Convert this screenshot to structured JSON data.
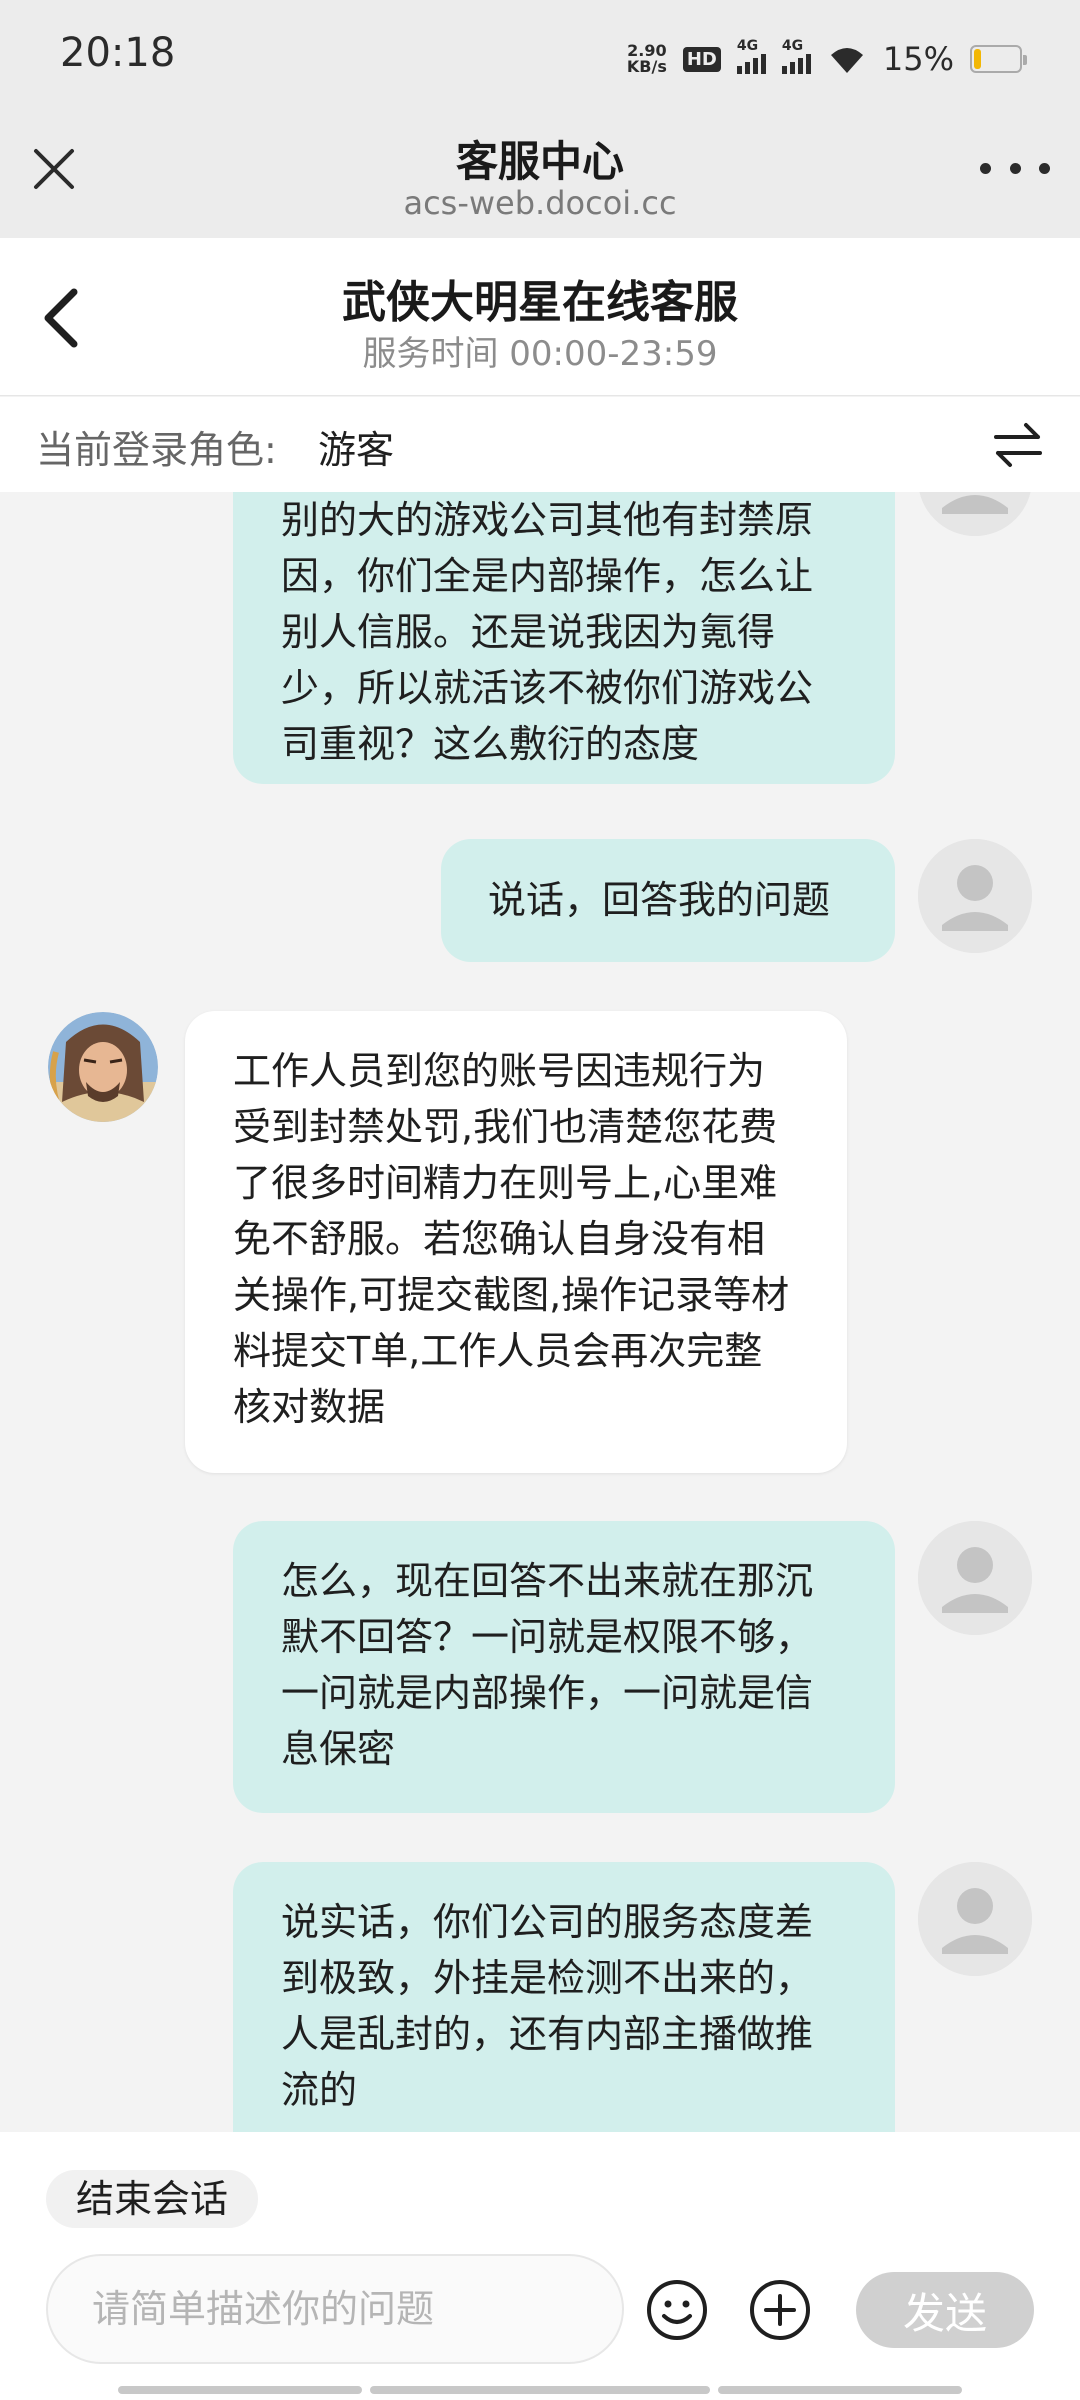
{
  "status_bar": {
    "time": "20:18",
    "net_speed_value": "2.90",
    "net_speed_unit": "KB/s",
    "hd_badge": "HD",
    "signal_1_label": "4G",
    "signal_2_label": "4G",
    "battery_percent": "15%",
    "battery_level": 0.15,
    "battery_color": "#f2b705"
  },
  "web_bar": {
    "title": "客服中心",
    "url": "acs-web.docoi.cc"
  },
  "chat_header": {
    "title": "武侠大明星在线客服",
    "service_hours": "服务时间 00:00-23:59"
  },
  "role_bar": {
    "label": "当前登录角色:",
    "value": "游客"
  },
  "messages": [
    {
      "sender": "user",
      "text": "别的大的游戏公司其他有封禁原因，你们全是内部操作，怎么让别人信服。还是说我因为氪得少，所以就活该不被你们游戏公司重视？这么敷衍的态度"
    },
    {
      "sender": "user",
      "text": "说话，回答我的问题"
    },
    {
      "sender": "agent",
      "text": "工作人员到您的账号因违规行为受到封禁处罚,我们也清楚您花费了很多时间精力在则号上,心里难免不舒服。若您确认自身没有相关操作,可提交截图,操作记录等材料提交T单,工作人员会再次完整核对数据"
    },
    {
      "sender": "user",
      "text": "怎么，现在回答不出来就在那沉默不回答？一问就是权限不够，一问就是内部操作，一问就是信息保密"
    },
    {
      "sender": "user",
      "text": "说实话，你们公司的服务态度差到极致，外挂是检测不出来的，人是乱封的，还有内部主播做推流的"
    }
  ],
  "footer": {
    "end_session_label": "结束会话",
    "input_placeholder": "请简单描述你的问题",
    "send_label": "发送"
  },
  "colors": {
    "user_bubble": "#d2efec",
    "agent_bubble": "#ffffff",
    "send_disabled": "#d0d0d0"
  }
}
